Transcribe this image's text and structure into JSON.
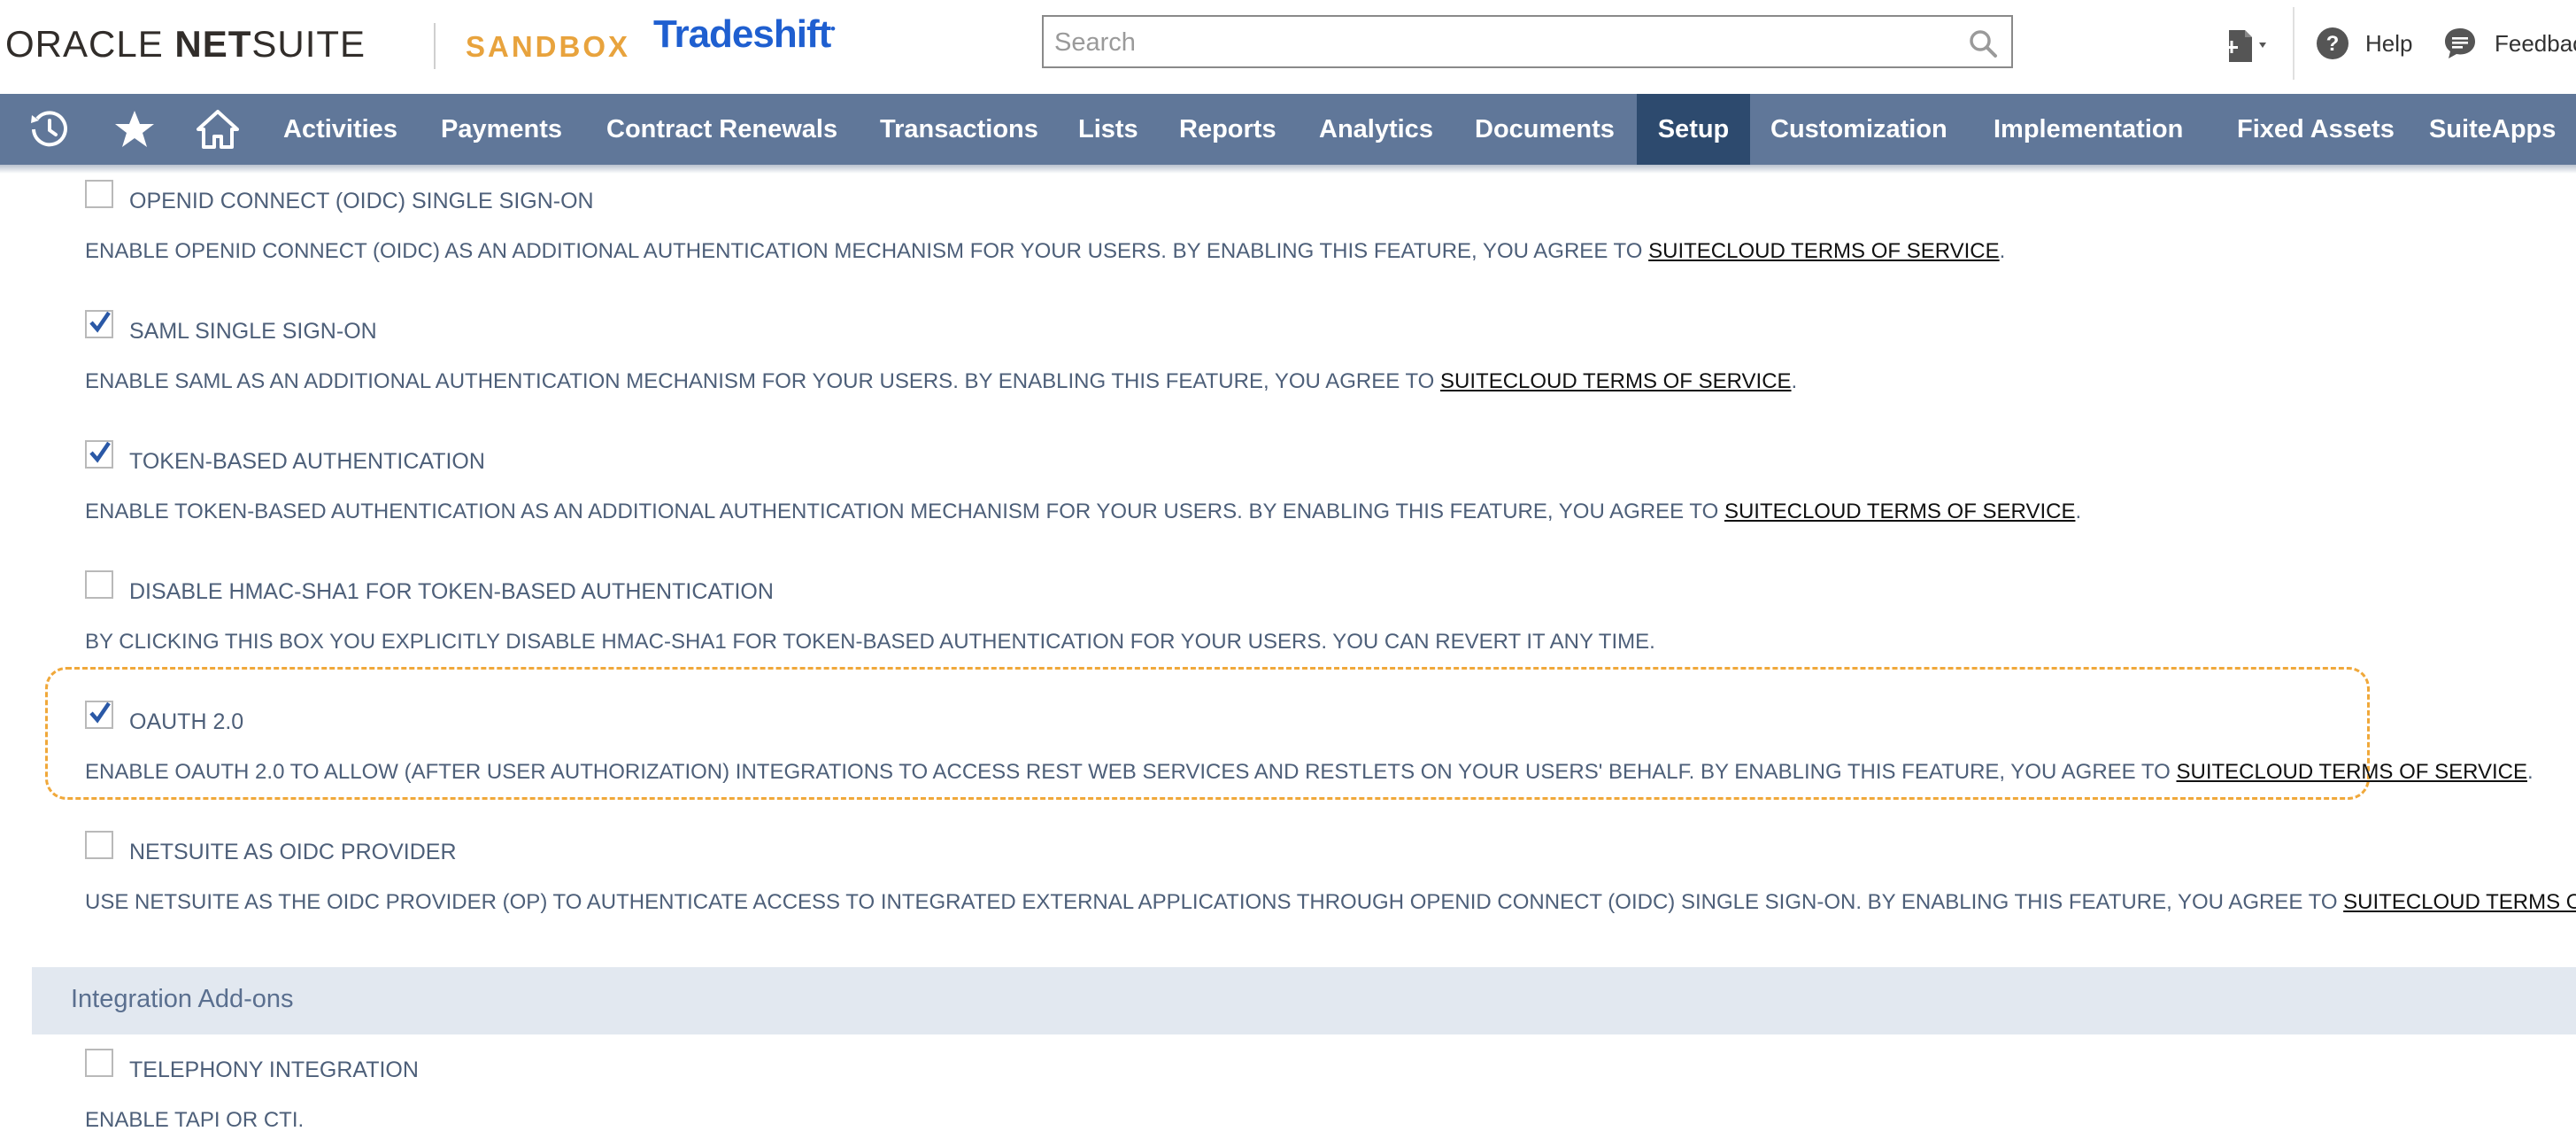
{
  "header": {
    "brand_oracle": "ORACLE",
    "brand_netsuite_bold": "NET",
    "brand_netsuite_light": "SUITE",
    "brand_sandbox": "SANDBOX",
    "brand_tradeshift": "Tradeshift",
    "search_placeholder": "Search",
    "help_label": "Help",
    "feedback_label": "Feedback"
  },
  "nav": {
    "items": [
      {
        "label": "Activities",
        "active": false
      },
      {
        "label": "Payments",
        "active": false
      },
      {
        "label": "Contract Renewals",
        "active": false
      },
      {
        "label": "Transactions",
        "active": false
      },
      {
        "label": "Lists",
        "active": false
      },
      {
        "label": "Reports",
        "active": false
      },
      {
        "label": "Analytics",
        "active": false
      },
      {
        "label": "Documents",
        "active": false
      },
      {
        "label": "Setup",
        "active": true
      },
      {
        "label": "Customization",
        "active": false
      },
      {
        "label": "Implementation",
        "active": false
      },
      {
        "label": "Fixed Assets",
        "active": false
      },
      {
        "label": "SuiteApps",
        "active": false
      }
    ]
  },
  "features": [
    {
      "label": "OPENID CONNECT (OIDC) SINGLE SIGN-ON",
      "checked": false,
      "desc": "ENABLE OPENID CONNECT (OIDC) AS AN ADDITIONAL AUTHENTICATION MECHANISM FOR YOUR USERS. BY ENABLING THIS FEATURE, YOU AGREE TO ",
      "link": "SUITECLOUD TERMS OF SERVICE",
      "after": "."
    },
    {
      "label": "SAML SINGLE SIGN-ON",
      "checked": true,
      "desc": "ENABLE SAML AS AN ADDITIONAL AUTHENTICATION MECHANISM FOR YOUR USERS. BY ENABLING THIS FEATURE, YOU AGREE TO ",
      "link": "SUITECLOUD TERMS OF SERVICE",
      "after": "."
    },
    {
      "label": "TOKEN-BASED AUTHENTICATION",
      "checked": true,
      "desc": "ENABLE TOKEN-BASED AUTHENTICATION AS AN ADDITIONAL AUTHENTICATION MECHANISM FOR YOUR USERS. BY ENABLING THIS FEATURE, YOU AGREE TO ",
      "link": "SUITECLOUD TERMS OF SERVICE",
      "after": "."
    },
    {
      "label": "DISABLE HMAC-SHA1 FOR TOKEN-BASED AUTHENTICATION",
      "checked": false,
      "desc": "BY CLICKING THIS BOX YOU EXPLICITLY DISABLE HMAC-SHA1 FOR TOKEN-BASED AUTHENTICATION FOR YOUR USERS. YOU CAN REVERT IT ANY TIME.",
      "link": "",
      "after": ""
    },
    {
      "label": "OAUTH 2.0",
      "checked": true,
      "desc": "ENABLE OAUTH 2.0 TO ALLOW (AFTER USER AUTHORIZATION) INTEGRATIONS TO ACCESS REST WEB SERVICES AND RESTLETS ON YOUR USERS' BEHALF. BY ENABLING THIS FEATURE, YOU AGREE TO ",
      "link": "SUITECLOUD TERMS OF SERVICE",
      "after": "."
    },
    {
      "label": "NETSUITE AS OIDC PROVIDER",
      "checked": false,
      "desc": "USE NETSUITE AS THE OIDC PROVIDER (OP) TO AUTHENTICATE ACCESS TO INTEGRATED EXTERNAL APPLICATIONS THROUGH OPENID CONNECT (OIDC) SINGLE SIGN-ON. BY ENABLING THIS FEATURE, YOU AGREE TO ",
      "link": "SUITECLOUD TERMS OF SERVICE",
      "after": "."
    }
  ],
  "section": {
    "title": "Integration Add-ons",
    "features": [
      {
        "label": "TELEPHONY INTEGRATION",
        "checked": false,
        "desc": "ENABLE TAPI OR CTI."
      }
    ]
  },
  "colors": {
    "nav_bg": "#607799",
    "nav_active": "#2d4a6e",
    "text": "#4d5f79",
    "highlight": "#f0a83a",
    "section_bg": "#e2e8f0"
  }
}
